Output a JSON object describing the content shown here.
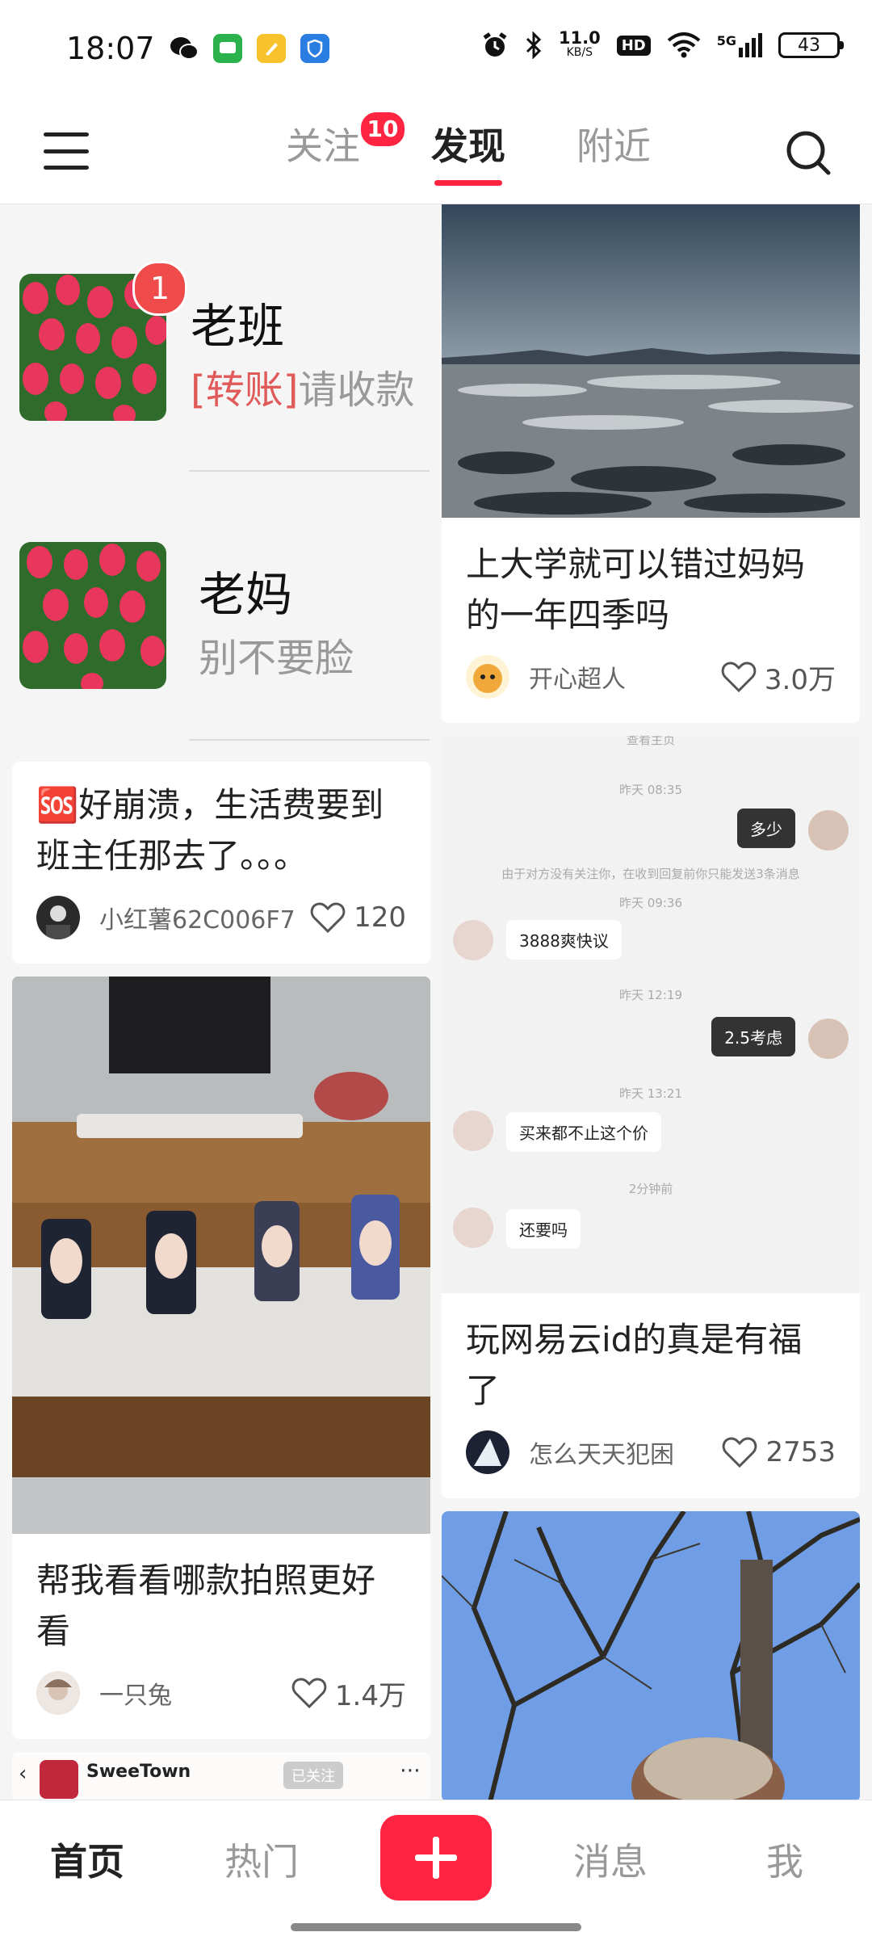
{
  "status_bar": {
    "time": "18:07",
    "net_speed_value": "11.0",
    "net_speed_unit": "KB/S",
    "hd_label": "HD",
    "signal_label": "5G",
    "battery": "43"
  },
  "top_nav": {
    "tabs": [
      {
        "label": "关注",
        "badge": "10"
      },
      {
        "label": "发现",
        "active": true
      },
      {
        "label": "附近"
      }
    ]
  },
  "conversations": [
    {
      "name": "老班",
      "tag": "[转账]",
      "message": "请收款",
      "unread": "1"
    },
    {
      "name": "老妈",
      "message": "别不要脸"
    }
  ],
  "cards_left": [
    {
      "title": "🆘好崩溃，生活费要到班主任那去了。。。",
      "author": "小红薯62C006F7",
      "likes": "120"
    },
    {
      "title": "帮我看看哪款拍照更好看",
      "author": "一只兔",
      "likes": "1.4万"
    },
    {
      "partial_app": "SweeTown",
      "partial_follow": "已关注"
    }
  ],
  "cards_right": [
    {
      "title": "上大学就可以错过妈妈的一年四季吗",
      "author": "开心超人",
      "likes": "3.0万"
    },
    {
      "title": "玩网易云id的真是有福了",
      "author": "怎么天天犯困",
      "likes": "2753",
      "chat": {
        "top_label": "查看主页",
        "time1": "昨天 08:35",
        "msg1": "多少",
        "notice": "由于对方没有关注你，在收到回复前你只能发送3条消息",
        "time2": "昨天 09:36",
        "msg2": "3888爽快议",
        "time3": "昨天 12:19",
        "msg3": "2.5考虑",
        "time4": "昨天 13:21",
        "msg4": "买来都不止这个价",
        "time5": "2分钟前",
        "msg5": "还要吗"
      }
    }
  ],
  "bottom_nav": {
    "home": "首页",
    "hot": "热门",
    "messages": "消息",
    "me": "我"
  },
  "colors": {
    "accent": "#ff2442",
    "unread_badge": "#ef4b4b"
  }
}
